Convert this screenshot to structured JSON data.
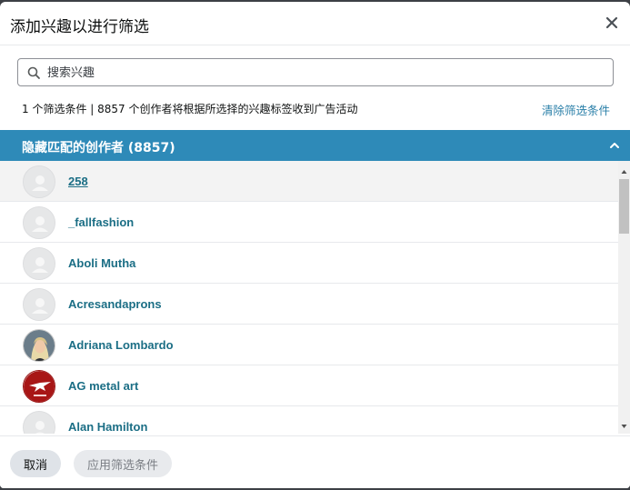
{
  "dialog": {
    "title": "添加兴趣以进行筛选",
    "close_icon": "close-icon"
  },
  "search": {
    "placeholder": "搜索兴趣",
    "icon": "search-icon"
  },
  "summary": {
    "text": "1 个筛选条件 | 8857 个创作者将根据所选择的兴趣标签收到广告活动",
    "clear_label": "清除筛选条件"
  },
  "section": {
    "title": "隐藏匹配的创作者 (8857)",
    "icon": "chevron-up-icon",
    "bar_color": "#2e8ab8"
  },
  "creators": [
    {
      "name": "258",
      "avatar": "default"
    },
    {
      "name": "_fallfashion",
      "avatar": "default"
    },
    {
      "name": "Aboli Mutha",
      "avatar": "default"
    },
    {
      "name": "Acresandaprons",
      "avatar": "default"
    },
    {
      "name": "Adriana Lombardo",
      "avatar": "photo"
    },
    {
      "name": "AG metal art",
      "avatar": "logo"
    },
    {
      "name": "Alan Hamilton",
      "avatar": "default"
    }
  ],
  "footer": {
    "cancel_label": "取消",
    "apply_label": "应用筛选条件"
  },
  "colors": {
    "link": "#1b6e85",
    "accent": "#2e8ab8"
  }
}
